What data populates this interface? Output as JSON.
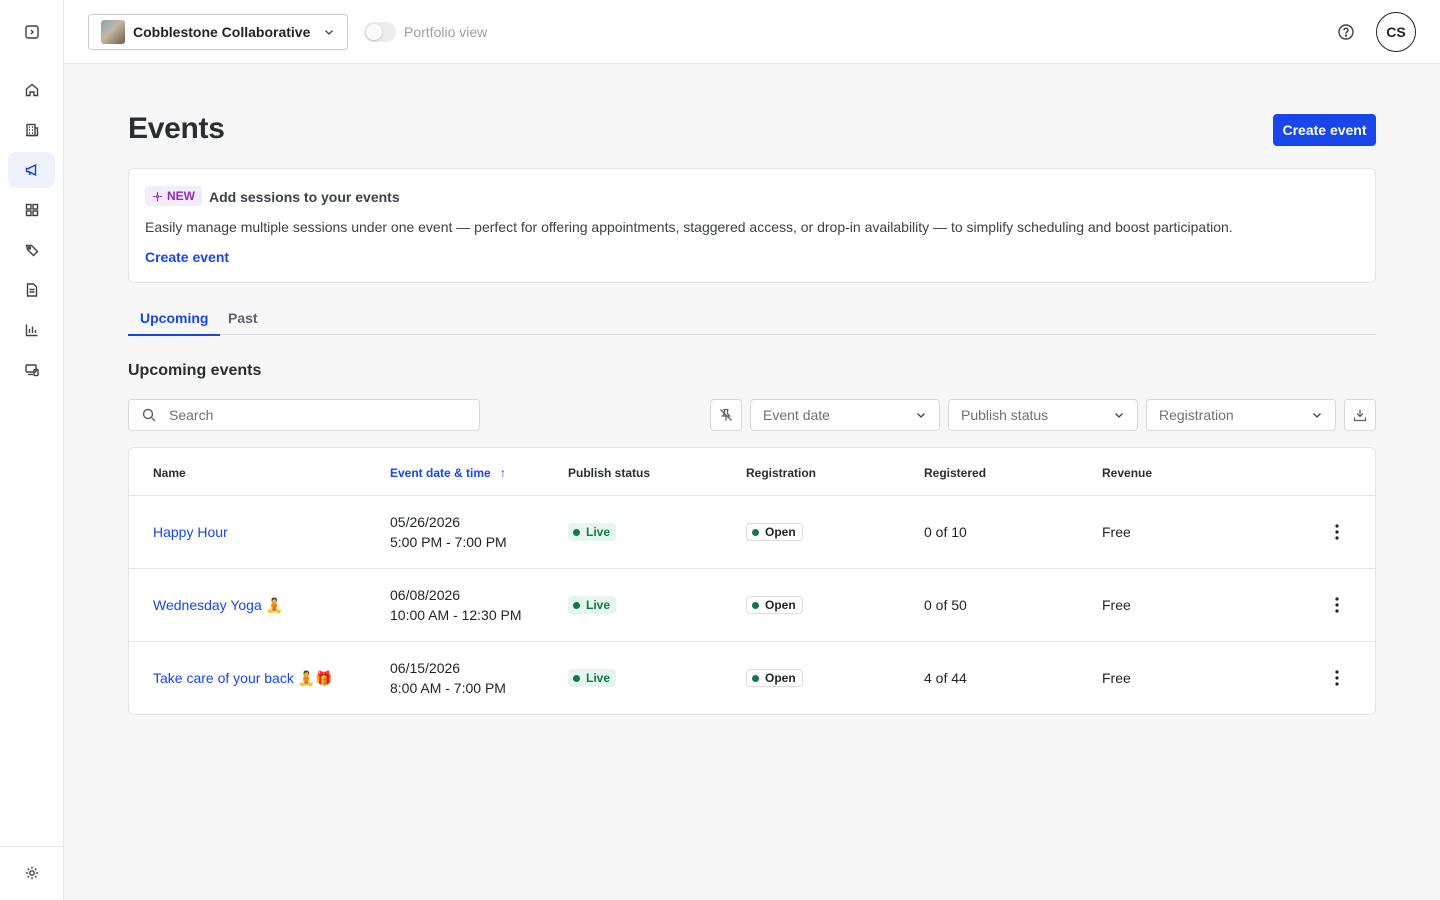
{
  "topbar": {
    "property_name": "Cobblestone Collaborative",
    "portfolio_label": "Portfolio view",
    "avatar_initials": "CS"
  },
  "sidebar": {
    "items": [
      {
        "icon": "sidebar-toggle-icon"
      },
      {
        "icon": "home-icon"
      },
      {
        "icon": "building-icon"
      },
      {
        "icon": "megaphone-icon",
        "active": true
      },
      {
        "icon": "apps-grid-icon"
      },
      {
        "icon": "tags-icon"
      },
      {
        "icon": "document-icon"
      },
      {
        "icon": "bar-chart-icon"
      },
      {
        "icon": "devices-icon"
      },
      {
        "icon": "gear-icon"
      }
    ]
  },
  "page": {
    "title": "Events",
    "create_button": "Create event"
  },
  "banner": {
    "badge": "NEW",
    "title": "Add sessions to your events",
    "text": "Easily manage multiple sessions under one event — perfect for offering appointments, staggered access, or drop-in availability — to simplify scheduling and boost participation.",
    "link": "Create event"
  },
  "tabs": [
    {
      "label": "Upcoming",
      "active": true
    },
    {
      "label": "Past",
      "active": false
    }
  ],
  "section_title": "Upcoming events",
  "search": {
    "placeholder": "Search"
  },
  "filters": {
    "event_date": "Event date",
    "publish_status": "Publish status",
    "registration": "Registration"
  },
  "table": {
    "columns": [
      "Name",
      "Event date & time",
      "Publish status",
      "Registration",
      "Registered",
      "Revenue"
    ],
    "sort_indicator": "↑",
    "rows": [
      {
        "name": "Happy Hour",
        "date": "05/26/2026",
        "time": "5:00 PM - 7:00 PM",
        "publish": "Live",
        "registration": "Open",
        "registered": "0 of 10",
        "revenue": "Free"
      },
      {
        "name": "Wednesday Yoga 🧘",
        "date": "06/08/2026",
        "time": "10:00 AM - 12:30 PM",
        "publish": "Live",
        "registration": "Open",
        "registered": "0 of 50",
        "revenue": "Free"
      },
      {
        "name": "Take care of your back 🧘🎁",
        "date": "06/15/2026",
        "time": "8:00 AM - 7:00 PM",
        "publish": "Live",
        "registration": "Open",
        "registered": "4 of 44",
        "revenue": "Free"
      }
    ]
  },
  "colors": {
    "accent": "#1846e8",
    "live_bg": "#e6f6ee",
    "live_text": "#0f7a45",
    "new_badge_bg": "#f4ecfb",
    "new_badge_text": "#8b2bbf"
  }
}
